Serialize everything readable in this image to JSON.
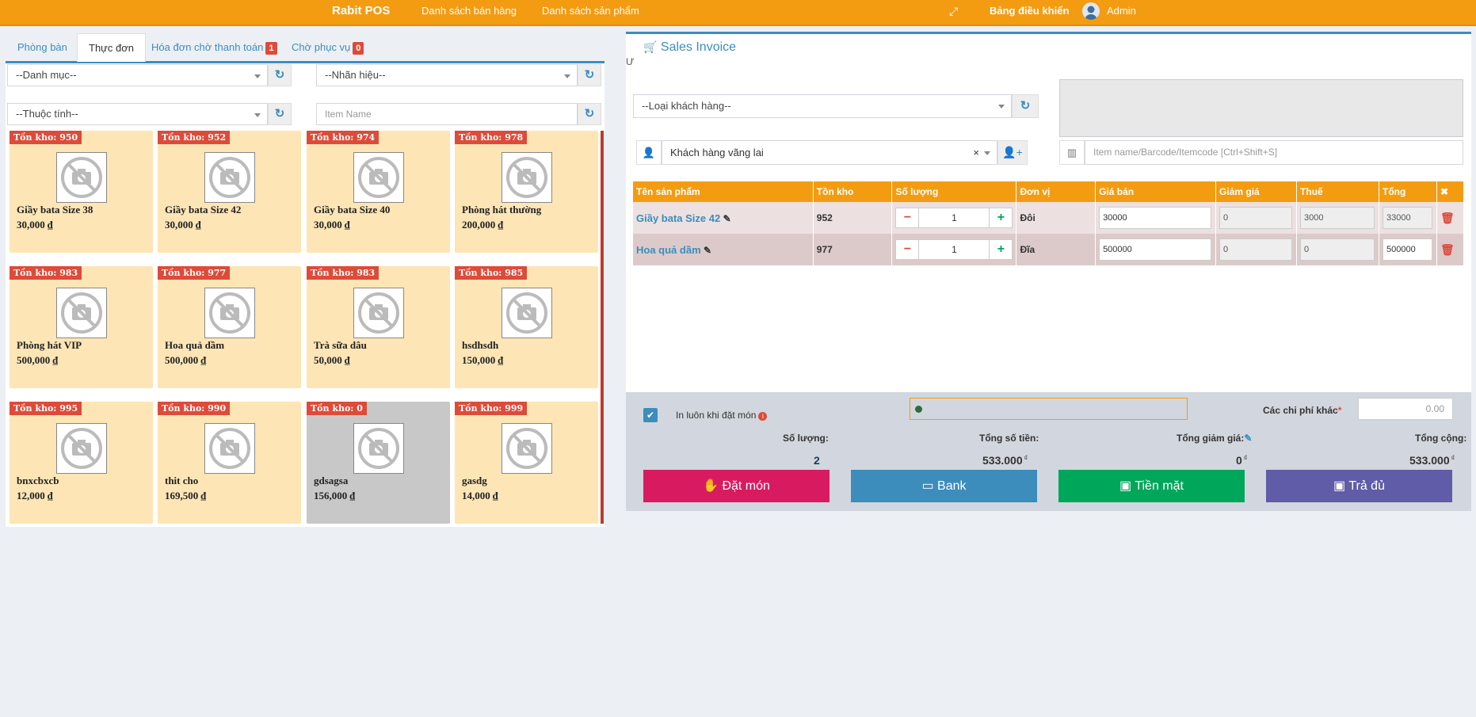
{
  "topbar": {
    "brand": "Rabit POS",
    "nav_sales_list": "Danh sách bán hàng",
    "nav_product_list": "Danh sách sản phẩm",
    "dashboard": "Bảng điều khiển",
    "user": "Admin",
    "color": "#f39c12"
  },
  "tabs": {
    "tables": "Phòng bàn",
    "menu": "Thực đơn",
    "pending": "Hóa đơn chờ thanh toán",
    "pending_count": "1",
    "waiting": "Chờ phục vụ",
    "waiting_count": "0"
  },
  "filters": {
    "category": "--Danh mục--",
    "brand": "--Nhãn hiệu--",
    "attribute": "--Thuộc tính--",
    "item_name_placeholder": "Item Name"
  },
  "products": [
    {
      "stock": "Tồn kho: 950",
      "name": "Giầy bata Size 38",
      "price": "30,000 ₫"
    },
    {
      "stock": "Tồn kho: 952",
      "name": "Giầy bata Size 42",
      "price": "30,000 ₫"
    },
    {
      "stock": "Tồn kho: 974",
      "name": "Giầy bata Size 40",
      "price": "30,000 ₫"
    },
    {
      "stock": "Tồn kho: 978",
      "name": "Phòng hát thường",
      "price": "200,000 ₫"
    },
    {
      "stock": "Tồn kho: 983",
      "name": "Phòng hát VIP",
      "price": "500,000 ₫"
    },
    {
      "stock": "Tồn kho: 977",
      "name": "Hoa quả dầm",
      "price": "500,000 ₫"
    },
    {
      "stock": "Tồn kho: 983",
      "name": "Trà sữa dâu",
      "price": "50,000 ₫"
    },
    {
      "stock": "Tồn kho: 985",
      "name": "hsdhsdh",
      "price": "150,000 ₫"
    },
    {
      "stock": "Tồn kho: 995",
      "name": "bnxcbxcb",
      "price": "12,000 ₫"
    },
    {
      "stock": "Tồn kho: 990",
      "name": "thit cho",
      "price": "169,500 ₫"
    },
    {
      "stock": "Tồn kho: 0",
      "name": "gdsagsa",
      "price": "156,000 ₫"
    },
    {
      "stock": "Tồn kho: 999",
      "name": "gasdg",
      "price": "14,000 ₫"
    }
  ],
  "invoice": {
    "title": "Sales Invoice",
    "stray_char": "Ư",
    "customer_type": "--Loại khách hàng--",
    "customer": "Khách hàng vãng lai",
    "barcode_placeholder": "Item name/Barcode/Itemcode [Ctrl+Shift+S]",
    "columns": [
      "Tên sản phẩm",
      "Tồn kho",
      "Số lượng",
      "Đơn vị",
      "Giá bán",
      "Giảm giá",
      "Thuế",
      "Tổng",
      "✖"
    ],
    "rows": [
      {
        "name": "Giầy bata Size 42",
        "stock": "952",
        "qty": "1",
        "unit": "Đôi",
        "price": "30000",
        "discount": "0",
        "tax": "3000",
        "total": "33000"
      },
      {
        "name": "Hoa quả dầm",
        "stock": "977",
        "qty": "1",
        "unit": "Đĩa",
        "price": "500000",
        "discount": "0",
        "tax": "0",
        "total": "500000"
      }
    ]
  },
  "summary": {
    "print_on_order": "In luôn khi đặt món",
    "other_costs_label": "Các chi phí khác",
    "other_costs_value": "0.00",
    "qty_label": "Số lượng:",
    "qty_value": "2",
    "total_amount_label": "Tổng số tiền:",
    "total_amount_value": "533.000",
    "total_discount_label": "Tổng giảm giá:",
    "total_discount_value": "0",
    "grand_total_label": "Tổng cộng:",
    "grand_total_value": "533.000",
    "currency": "₫"
  },
  "actions": {
    "order": "Đặt món",
    "bank": "Bank",
    "cash": "Tiền mặt",
    "pay_full": "Trả đủ",
    "colors": {
      "order": "#d81b60",
      "bank": "#3c8dbc",
      "cash": "#00a65a",
      "pay_full": "#605ca8"
    }
  }
}
